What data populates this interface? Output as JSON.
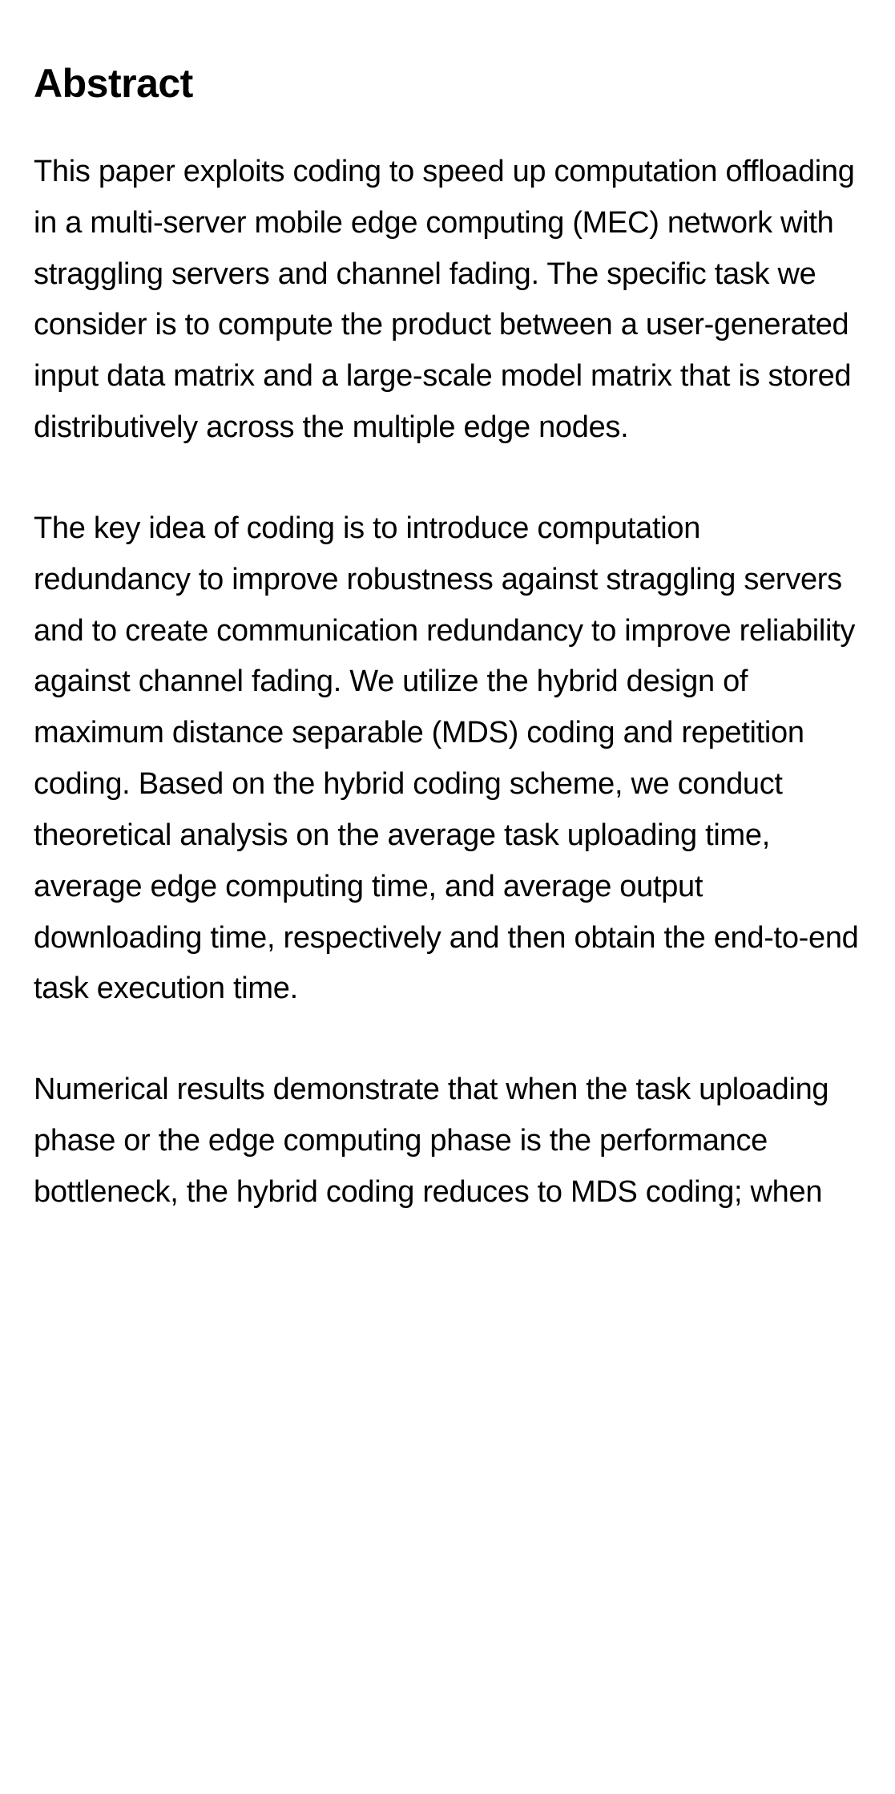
{
  "abstract": {
    "heading": "Abstract",
    "paragraphs": [
      "This paper exploits coding to speed up computation offloading in a multi-server mobile edge computing (MEC) network with straggling servers and channel fading. The specific task we consider is to compute the product between a user-generated input data matrix and a large-scale model matrix that is stored distributively across the multiple edge nodes.",
      "The key idea of coding is to introduce computation redundancy to improve robustness against straggling servers and to create communication redundancy to improve reliability against channel fading. We utilize the hybrid design of maximum distance separable (MDS) coding and repetition coding. Based on the hybrid coding scheme, we conduct theoretical analysis on the average task uploading time, average edge computing time, and average output downloading time, respectively and then obtain the end-to-end task execution time.",
      "Numerical results demonstrate that when the task uploading phase or the edge computing phase is the performance bottleneck, the hybrid coding reduces to MDS coding; when"
    ]
  }
}
